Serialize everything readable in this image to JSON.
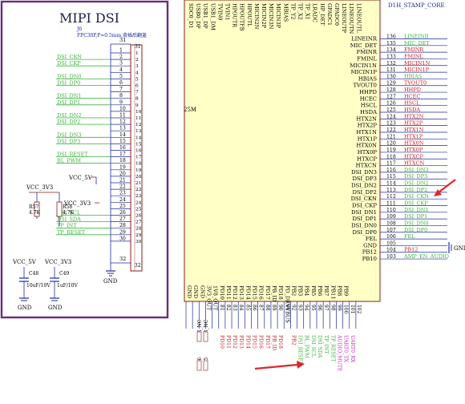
{
  "left_panel": {
    "title": "MIPI DSI",
    "connector": {
      "ref": "J6",
      "desc": "FPC30P,P=0.5mm,背插后翻盖",
      "top_pin": "31",
      "bottom_pin": "32",
      "pins": [
        {
          "num": "1",
          "net": ""
        },
        {
          "num": "2",
          "net": "DSI_CKN"
        },
        {
          "num": "3",
          "net": "DSI_CKP"
        },
        {
          "num": "4",
          "net": ""
        },
        {
          "num": "5",
          "net": "DSI_DN0"
        },
        {
          "num": "6",
          "net": "DSI_DP0"
        },
        {
          "num": "7",
          "net": ""
        },
        {
          "num": "8",
          "net": "DSI_DN1"
        },
        {
          "num": "9",
          "net": "DSI_DP1"
        },
        {
          "num": "10",
          "net": ""
        },
        {
          "num": "11",
          "net": "DSI_DN2"
        },
        {
          "num": "12",
          "net": "DSI_DP2"
        },
        {
          "num": "13",
          "net": ""
        },
        {
          "num": "14",
          "net": "DSI_DN3"
        },
        {
          "num": "15",
          "net": "DSI_DP3"
        },
        {
          "num": "16",
          "net": ""
        },
        {
          "num": "17",
          "net": "DSI_RESET"
        },
        {
          "num": "18",
          "net": "BL_PWM"
        },
        {
          "num": "19",
          "net": ""
        },
        {
          "num": "20",
          "net": ""
        },
        {
          "num": "21",
          "net": ""
        },
        {
          "num": "22",
          "net": ""
        },
        {
          "num": "23",
          "net": ""
        },
        {
          "num": "24",
          "net": ""
        },
        {
          "num": "25",
          "net": ""
        },
        {
          "num": "26",
          "net": "DSI_SCL"
        },
        {
          "num": "27",
          "net": "DSI_SDA"
        },
        {
          "num": "28",
          "net": "TP_INT"
        },
        {
          "num": "29",
          "net": "TP_RESET"
        },
        {
          "num": "30",
          "net": ""
        }
      ]
    },
    "power": {
      "vcc5v": "VCC_5V",
      "vcc3v3": "VCC_3V3",
      "gnd": "GND"
    },
    "resistors": [
      {
        "ref": "R57",
        "value": "4.7K"
      },
      {
        "ref": "R58",
        "value": "4.7K"
      }
    ],
    "capacitors": [
      {
        "ref": "C48",
        "value": "10uF/10V",
        "rail": "VCC_5V"
      },
      {
        "ref": "C49",
        "value": "1uF/10V",
        "rail": "VCC_3V3"
      }
    ]
  },
  "right_panel": {
    "chip_label": "D1H_STAMP_CORE",
    "chip_suffix": "25M",
    "top_pins": [
      "SDC0_D1",
      "USB0_DP",
      "USB1_DP",
      "USB1_DM",
      "TVIN0",
      "TVIN1",
      "HPOUTR",
      "HPOUTFB",
      "HPOUTL",
      "MICIN2N",
      "MICIN2P",
      "MICIN3N",
      "MICIN3P",
      "MBIAS",
      "TP_Y2",
      "TP_X2",
      "TP_X1",
      "LRADC",
      "HP_DET",
      "GPADC1",
      "GPADC0",
      "LINEOUTP",
      "LINEOUTN",
      "LINEOUTL"
    ],
    "right_pins": [
      {
        "name": "LINEINR",
        "num": "136",
        "net": "LINEINR"
      },
      {
        "name": "MIC_DET",
        "num": "135",
        "net": "MIC_DET"
      },
      {
        "name": "FMINR",
        "num": "134",
        "net": "FMINR"
      },
      {
        "name": "FMINL",
        "num": "133",
        "net": "FMINL"
      },
      {
        "name": "MICIN1N",
        "num": "132",
        "net": "MICIN1N"
      },
      {
        "name": "MICIN1P",
        "num": "131",
        "net": "MICIN1P"
      },
      {
        "name": "HBIAS",
        "num": "130",
        "net": "HBIAS"
      },
      {
        "name": "TVOUT0",
        "num": "129",
        "net": "TVOUT0"
      },
      {
        "name": "HHPD",
        "num": "128",
        "net": "HHPD"
      },
      {
        "name": "HCEC",
        "num": "127",
        "net": "HCEC"
      },
      {
        "name": "HSCL",
        "num": "126",
        "net": "HSCL"
      },
      {
        "name": "HSDA",
        "num": "125",
        "net": "HSDA"
      },
      {
        "name": "HTX2N",
        "num": "124",
        "net": "HTX2N"
      },
      {
        "name": "HTX2P",
        "num": "123",
        "net": "HTX2P"
      },
      {
        "name": "HTX1N",
        "num": "122",
        "net": "HTX1N"
      },
      {
        "name": "HTX1P",
        "num": "121",
        "net": "HTX1P"
      },
      {
        "name": "HTX0N",
        "num": "120",
        "net": "HTX0N"
      },
      {
        "name": "HTX0P",
        "num": "119",
        "net": "HTX0P"
      },
      {
        "name": "HTXCP",
        "num": "118",
        "net": "HTXCP"
      },
      {
        "name": "HTXCN",
        "num": "117",
        "net": "HTXCN"
      },
      {
        "name": "DSI_DN3",
        "num": "116",
        "net": "DSI_DN3"
      },
      {
        "name": "DSI_DP3",
        "num": "115",
        "net": "DSI_DP3"
      },
      {
        "name": "DSI_DN2",
        "num": "114",
        "net": "DSI_DN2"
      },
      {
        "name": "DSI_DP2",
        "num": "113",
        "net": "DSI_DP2"
      },
      {
        "name": "DSI_CKN",
        "num": "112",
        "net": "DSI_CKN"
      },
      {
        "name": "DSI_CKP",
        "num": "111",
        "net": "DSI_CKP"
      },
      {
        "name": "DSI_DN1",
        "num": "110",
        "net": "DSI_DN1"
      },
      {
        "name": "DSI_DP1",
        "num": "109",
        "net": "DSI_DP1"
      },
      {
        "name": "DSI_DN0",
        "num": "108",
        "net": "DSI_DN0"
      },
      {
        "name": "DSI_DP0",
        "num": "107",
        "net": "DSI_DP0"
      },
      {
        "name": "FEL",
        "num": "106",
        "net": "FEL"
      },
      {
        "name": "GND",
        "num": "105",
        "net": ""
      },
      {
        "name": "PB12",
        "num": "104",
        "net": "PB12"
      },
      {
        "name": "PB10",
        "num": "103",
        "net": "AMP_EN_AUDIO"
      }
    ],
    "gnd_label": "GND",
    "bottom_pins": [
      {
        "name": "GND",
        "num": "",
        "net": ""
      },
      {
        "name": "GND",
        "num": "",
        "net": ""
      },
      {
        "name": "GND",
        "num": "",
        "net": ""
      },
      {
        "name": "3V3_OUT",
        "num": "",
        "net": ""
      },
      {
        "name": "1V8_OUT",
        "num": "",
        "net": ""
      },
      {
        "name": "PD10",
        "num": "81",
        "net": ""
      },
      {
        "name": "PD11",
        "num": "82",
        "net": ""
      },
      {
        "name": "PD12",
        "num": "83",
        "net": ""
      },
      {
        "name": "PD13",
        "num": "84",
        "net": ""
      },
      {
        "name": "PD14",
        "num": "85",
        "net": ""
      },
      {
        "name": "PD15",
        "num": "86",
        "net": ""
      },
      {
        "name": "PD16",
        "num": "87",
        "net": ""
      },
      {
        "name": "PD17",
        "num": "88",
        "net": ""
      },
      {
        "name": "PB_ID",
        "num": "89",
        "net": ""
      },
      {
        "name": "PD18",
        "num": "90",
        "net": ""
      },
      {
        "name": "PD_DRVVBUS",
        "num": "91",
        "net": ""
      },
      {
        "name": "PB2",
        "num": "92",
        "net": "PB2"
      },
      {
        "name": "PB3",
        "num": "93",
        "net": "DSI_RESET"
      },
      {
        "name": "PB4",
        "num": "94",
        "net": "BL_PWM"
      },
      {
        "name": "PB5",
        "num": "95",
        "net": "DSI_SCL"
      },
      {
        "name": "PB6",
        "num": "96",
        "net": "DSI_SDA"
      },
      {
        "name": "PB7",
        "num": "97",
        "net": "TP_INT"
      },
      {
        "name": "PB11",
        "num": "98",
        "net": "TP_RESET"
      },
      {
        "name": "PB8",
        "num": "99",
        "net": "AUDIO_MUTE"
      },
      {
        "name": "PB9",
        "num": "100",
        "net": "UART0_TX"
      },
      {
        "name": "",
        "num": "101",
        "net": "UART0_RX"
      },
      {
        "name": "",
        "num": "102",
        "net": ""
      }
    ],
    "left_column_nets": [
      "PD10",
      "PD11",
      "PD12",
      "PD13",
      "PD14",
      "PD15",
      "PD16",
      "PD17",
      "PB_ID",
      "PD18"
    ],
    "resistor_labels": [
      "8R_NC",
      "8R_NC",
      "R66",
      "R65"
    ]
  },
  "colors": {
    "frame": "#6a2c7a",
    "green_net": "#3cb43c",
    "red_net": "#c8202a",
    "blue": "#1c2a9c",
    "chip_fill": "#ffffc6",
    "chip_border": "#8a1c1c",
    "arrow": "#e0262a",
    "magenta": "#c030c0"
  }
}
